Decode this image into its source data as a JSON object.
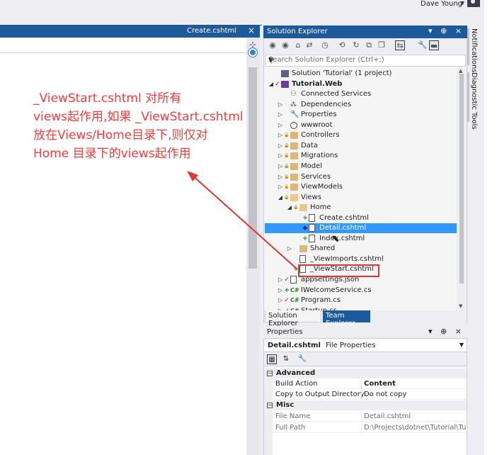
{
  "user": {
    "name": "Dave Young"
  },
  "editor": {
    "tab_label": "Create.cshtml",
    "annotation_lines": [
      "_ViewStart.cshtml 对所有",
      "views起作用,如果 _ViewStart.cshtml",
      "放在Views/Home目录下,则仅对",
      "Home 目录下的views起作用"
    ]
  },
  "solution_explorer": {
    "title": "Solution Explorer",
    "search_placeholder": "Search Solution Explorer (Ctrl+;)",
    "tree": [
      {
        "label": "Solution 'Tutorial' (1 project)",
        "icon": "solution-icon",
        "level": 0,
        "expander": "",
        "status": ""
      },
      {
        "label": "Tutorial.Web",
        "icon": "project-icon",
        "level": 0,
        "expander": "◢",
        "status": "✓",
        "bold": true
      },
      {
        "label": "Connected Services",
        "icon": "connected-services-icon",
        "level": 1,
        "expander": "",
        "status": ""
      },
      {
        "label": "Dependencies",
        "icon": "dependencies-icon",
        "level": 1,
        "expander": "▷",
        "status": ""
      },
      {
        "label": "Properties",
        "icon": "wrench-icon",
        "level": 1,
        "expander": "▷",
        "status": ""
      },
      {
        "label": "wwwroot",
        "icon": "globe-icon",
        "level": 1,
        "expander": "▷",
        "status": ""
      },
      {
        "label": "Controllers",
        "icon": "folder-icon",
        "level": 1,
        "expander": "▷",
        "status": "🔒"
      },
      {
        "label": "Data",
        "icon": "folder-icon",
        "level": 1,
        "expander": "▷",
        "status": "🔒"
      },
      {
        "label": "Migrations",
        "icon": "folder-icon",
        "level": 1,
        "expander": "▷",
        "status": "🔒"
      },
      {
        "label": "Model",
        "icon": "folder-icon",
        "level": 1,
        "expander": "▷",
        "status": "🔒"
      },
      {
        "label": "Services",
        "icon": "folder-icon",
        "level": 1,
        "expander": "▷",
        "status": "🔒"
      },
      {
        "label": "ViewModels",
        "icon": "folder-icon",
        "level": 1,
        "expander": "▷",
        "status": "🔒"
      },
      {
        "label": "Views",
        "icon": "folder-open-icon",
        "level": 1,
        "expander": "◢",
        "status": "🔒"
      },
      {
        "label": "Home",
        "icon": "folder-open-icon",
        "level": 2,
        "expander": "◢",
        "status": "🔒"
      },
      {
        "label": "Create.cshtml",
        "icon": "razor-file-icon",
        "level": 3,
        "expander": "",
        "status": "+"
      },
      {
        "label": "Detail.cshtml",
        "icon": "razor-file-icon",
        "level": 3,
        "expander": "",
        "status": "◆",
        "selected": true
      },
      {
        "label": "Index.cshtml",
        "icon": "razor-file-icon",
        "level": 3,
        "expander": "",
        "status": "+"
      },
      {
        "label": "Shared",
        "icon": "folder-icon",
        "level": 2,
        "expander": "▷",
        "status": ""
      },
      {
        "label": "_ViewImports.cshtml",
        "icon": "razor-file-icon",
        "level": 2,
        "expander": "",
        "status": ""
      },
      {
        "label": "_ViewStart.cshtml",
        "icon": "razor-file-icon",
        "level": 2,
        "expander": "",
        "status": "+"
      },
      {
        "label": "appsettings.json",
        "icon": "json-file-icon",
        "level": 1,
        "expander": "▷",
        "status": "✓"
      },
      {
        "label": "IWelcomeService.cs",
        "icon": "csharp-file-icon",
        "level": 1,
        "expander": "▷",
        "status": "+"
      },
      {
        "label": "Program.cs",
        "icon": "csharp-file-icon",
        "level": 1,
        "expander": "▷",
        "status": "✓"
      },
      {
        "label": "Startup.cs",
        "icon": "csharp-file-icon",
        "level": 1,
        "expander": "▷",
        "status": "✓"
      }
    ],
    "tabs": [
      "Solution Explorer",
      "Team Explorer"
    ]
  },
  "side_tabs": [
    "Notifications",
    "Diagnostic Tools"
  ],
  "properties": {
    "title": "Properties",
    "object_name": "Detail.cshtml",
    "object_type": "File Properties",
    "categories": [
      {
        "name": "Advanced",
        "rows": [
          {
            "key": "Build Action",
            "value": "Content",
            "bold": true
          },
          {
            "key": "Copy to Output Directory",
            "value": "Do not copy"
          }
        ]
      },
      {
        "name": "Misc",
        "rows": [
          {
            "key": "File Name",
            "value": "Detail.cshtml",
            "dim": true
          },
          {
            "key": "Full Path",
            "value": "D:\\Projects\\dotnet\\Tutorial\\Tutorial.Web\\Views\\Home\\Detail.cshtml",
            "dim": true
          }
        ]
      }
    ]
  },
  "colors": {
    "accent": "#1c5a9c",
    "selection": "#3399ff",
    "annotation": "#ff3a3a",
    "highlight_box": "#e8332e"
  }
}
